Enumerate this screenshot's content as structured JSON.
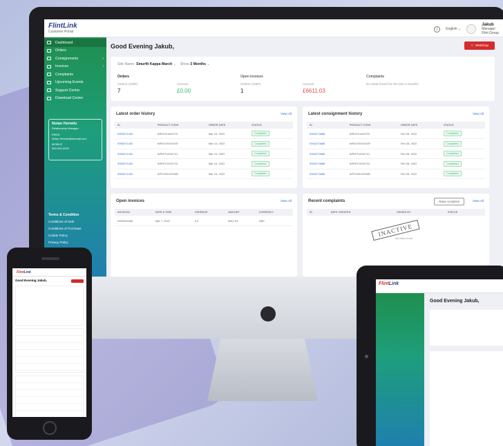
{
  "app": {
    "brand": "Flint",
    "brand_suffix": "Link",
    "subtitle": "Customer Portal"
  },
  "header": {
    "language": "English",
    "user_name": "Jakub",
    "user_role": "Manager",
    "user_company": "Flint Group"
  },
  "sidebar": {
    "items": [
      {
        "label": "Dashboard",
        "icon": "grid-icon",
        "active": true
      },
      {
        "label": "Orders",
        "icon": "list-icon"
      },
      {
        "label": "Consignments",
        "icon": "truck-icon",
        "arrow": true
      },
      {
        "label": "Invoices",
        "icon": "invoice-icon",
        "arrow": true
      },
      {
        "label": "Complaints",
        "icon": "complaint-icon"
      },
      {
        "label": "Upcoming Events",
        "icon": "calendar-icon"
      },
      {
        "label": "Support Centre",
        "icon": "support-icon"
      },
      {
        "label": "Download Centre",
        "icon": "download-icon"
      }
    ],
    "manager": {
      "name": "Nolan Herwitz",
      "role": "Relationship Manager",
      "email_label": "EMAIL",
      "email": "Nolan.Herwitz@hotmail.com",
      "mobile_label": "MOBILE",
      "mobile": "000-000-0000"
    },
    "links": {
      "title": "Terms & Condition",
      "items": [
        "Conditions of Sale",
        "Conditions of Purchase",
        "Cookie Policy",
        "Privacy Policy"
      ]
    }
  },
  "main": {
    "greeting": "Good Evening Jakub,",
    "webshop_label": "Webshop",
    "filters": {
      "site_label": "Site Name",
      "site_value": "Smurfit Kappa March",
      "show_label": "Show",
      "show_value": "3 Months"
    },
    "summary": {
      "orders": {
        "title": "Orders",
        "count_label": "Orders (GBP)",
        "count": "7",
        "amount_label": "Amount",
        "amount": "£0.00"
      },
      "invoices": {
        "title": "Open invoices",
        "count_label": "Orders (GBP)",
        "count": "1",
        "amount_label": "Amount",
        "amount": "£6611.03"
      },
      "complaints": {
        "title": "Complaints",
        "note": "No Data found for the last 3 months"
      }
    },
    "order_history": {
      "title": "Latest order history",
      "view_all": "View All",
      "columns": [
        "ID",
        "PRODUCT CODE",
        "ORDER DATE",
        "STATUS"
      ],
      "rows": [
        [
          "0050071420",
          "WRIC014G0710",
          "Mar 14, 2022",
          "Completed"
        ],
        [
          "0050071420",
          "WRIG70SG016F",
          "Mar 14, 2022",
          "Completed"
        ],
        [
          "0050071420",
          "WRIF704G0710",
          "Mar 14, 2022",
          "Completed"
        ],
        [
          "0050071420",
          "WRIS701G0710",
          "Mar 14, 2022",
          "Completed"
        ],
        [
          "0050071420",
          "WP10301G016B",
          "Mar 14, 2022",
          "Completed"
        ]
      ]
    },
    "consignment_history": {
      "title": "Latest consignment history",
      "view_all": "View All",
      "columns": [
        "ID",
        "PRODUCT CODE",
        "ORDER DATE",
        "STATUS"
      ],
      "rows": [
        [
          "0054273686",
          "WRIC014G0710",
          "Feb 28, 2022",
          "Completed"
        ],
        [
          "0054273686",
          "WRIG70SG016F",
          "Feb 28, 2022",
          "Completed"
        ],
        [
          "0054273686",
          "WRIF704G0710",
          "Feb 28, 2022",
          "Completed"
        ],
        [
          "0054273686",
          "WRIS701G0710",
          "Feb 28, 2022",
          "Completed"
        ],
        [
          "0054273686",
          "WP10301G016B",
          "Feb 28, 2022",
          "Completed"
        ]
      ]
    },
    "open_invoices": {
      "title": "Open invoices",
      "view_all": "View All",
      "columns": [
        "INVOICE#",
        "DATE & TIME",
        "OVERDUE",
        "AMOUNT",
        "CURRENCY"
      ],
      "rows": [
        [
          "0000041836",
          "Mar 7, 2022",
          "0.0",
          "6611.03",
          "GBP"
        ]
      ]
    },
    "recent_complaints": {
      "title": "Recent complaints",
      "raise_label": "Raise complaint",
      "view_all": "View All",
      "columns": [
        "ID",
        "DATE CREATED",
        "RAISED BY",
        "STATUS"
      ],
      "stamp": "INACTIVE",
      "empty_note": "No data found"
    }
  },
  "tablet": {
    "greeting": "Good Evening Jakub,",
    "site": "Smurfit Kappa March"
  },
  "phone": {
    "greeting": "Good Evening Jakub,"
  }
}
